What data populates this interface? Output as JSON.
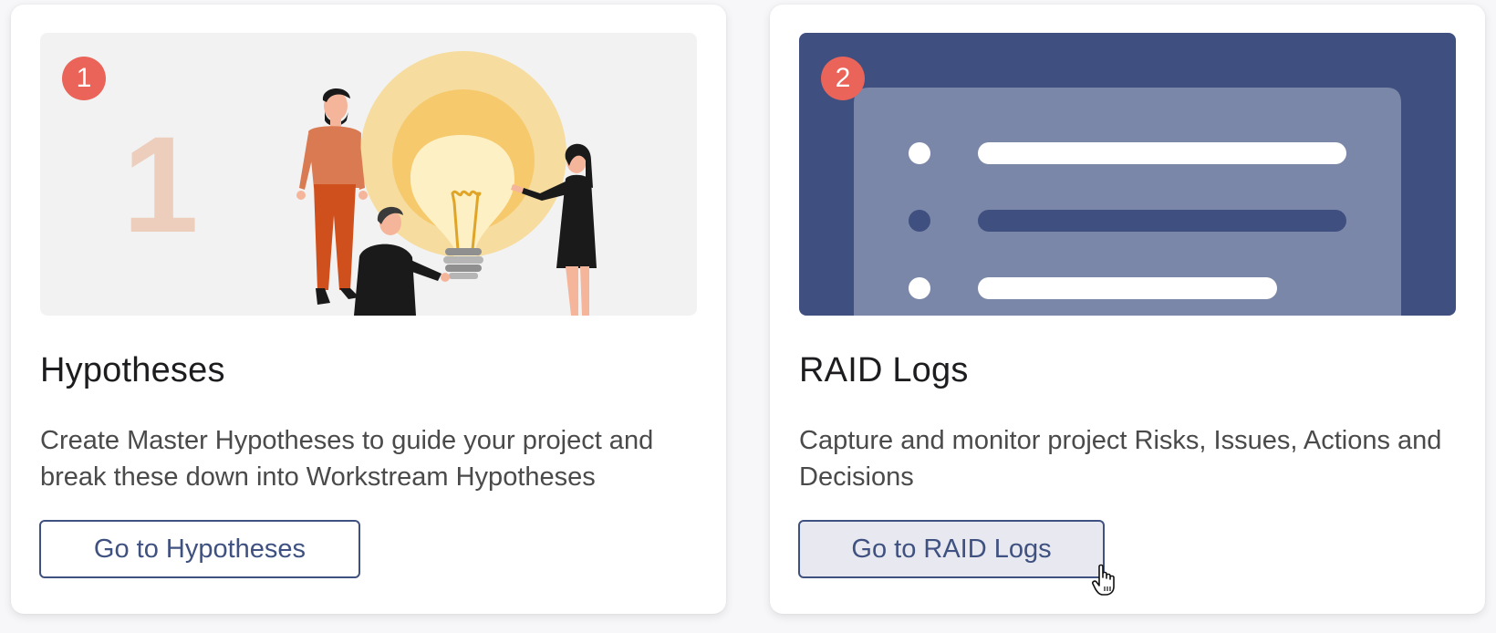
{
  "cards": [
    {
      "badge": "1",
      "big_number": "1",
      "title": "Hypotheses",
      "description": "Create Master Hypotheses to guide your project and break these down into Workstream Hypotheses",
      "button_label": "Go to Hypotheses"
    },
    {
      "badge": "2",
      "title": "RAID Logs",
      "description": "Capture and monitor project Risks, Issues, Actions and Decisions",
      "button_label": "Go to RAID Logs"
    }
  ],
  "colors": {
    "badge": "#ea6459",
    "accent": "#3f5180",
    "raid_background": "#3f5080",
    "raid_panel": "#7b87a9"
  },
  "icons": {
    "hypotheses_illustration": "people-lightbulb-illustration",
    "raid_illustration": "bulleted-list-illustration",
    "cursor": "hand-pointer-cursor"
  }
}
